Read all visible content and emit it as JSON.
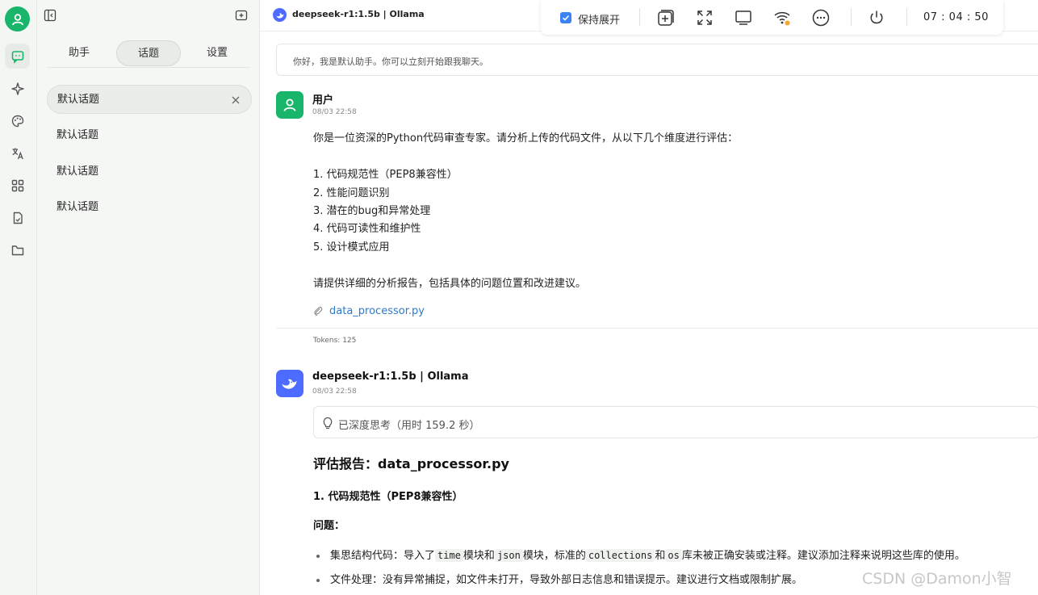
{
  "rail": {
    "items": [
      {
        "icon": "chat-icon",
        "active": true
      },
      {
        "icon": "sparkle-icon",
        "active": false
      },
      {
        "icon": "palette-icon",
        "active": false
      },
      {
        "icon": "translate-icon",
        "active": false
      },
      {
        "icon": "apps-grid-icon",
        "active": false
      },
      {
        "icon": "document-icon",
        "active": false
      },
      {
        "icon": "folder-icon",
        "active": false
      }
    ]
  },
  "panel": {
    "tabs": [
      "助手",
      "话题",
      "设置"
    ],
    "active_tab": "话题",
    "topics": [
      "默认话题",
      "默认话题",
      "默认话题",
      "默认话题"
    ]
  },
  "main": {
    "title": "deepseek-r1:1.5b | Ollama",
    "greeting": "你好，我是默认助手。你可以立刻开始跟我聊天。"
  },
  "sysbar": {
    "keep_expanded_label": "保持展开",
    "keep_expanded_checked": true,
    "clock": "07 : 04 : 50"
  },
  "user_message": {
    "sender": "用户",
    "time": "08/03 22:58",
    "lines": [
      "你是一位资深的Python代码审查专家。请分析上传的代码文件，从以下几个维度进行评估：",
      "1. 代码规范性（PEP8兼容性）",
      "2. 性能问题识别",
      "3. 潜在的bug和异常处理",
      "4. 代码可读性和维护性",
      "5. 设计模式应用",
      "请提供详细的分析报告，包括具体的问题位置和改进建议。"
    ],
    "attachment": "data_processor.py",
    "tokens": "Tokens: 125"
  },
  "assistant_message": {
    "sender": "deepseek-r1:1.5b | Ollama",
    "time": "08/03 22:58",
    "thinking": "已深度思考（用时 159.2 秒）",
    "heading": "评估报告：data_processor.py",
    "section": "1. 代码规范性（PEP8兼容性）",
    "subsection": "问题：",
    "bullet1": {
      "t1": "集思结构代码：导入了",
      "c1": "time",
      "t2": "模块和",
      "c2": "json",
      "t3": "模块，标准的",
      "c3": "collections",
      "t4": "和",
      "c4": "os",
      "t5": "库未被正确安装或注释。建议添加注释来说明这些库的使用。"
    },
    "bullet2": "文件处理：没有异常捕捉，如文件未打开，导致外部日志信息和错误提示。建议进行文档或限制扩展。"
  },
  "watermark": "CSDN @Damon小智",
  "colors": {
    "accent_green": "#19b56a",
    "deepseek_blue": "#4d6bfe",
    "link_blue": "#2f7ac9",
    "checkbox_blue": "#3b82f6",
    "status_orange": "#f5a623"
  }
}
